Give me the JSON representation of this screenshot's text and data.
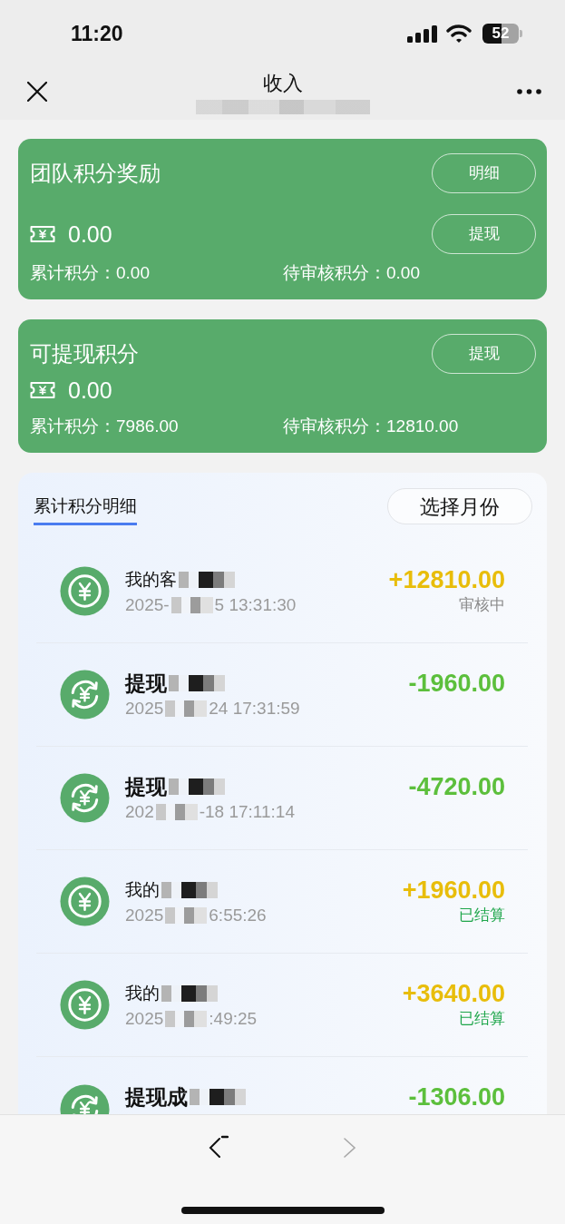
{
  "status_bar": {
    "time": "11:20",
    "battery": "52"
  },
  "nav": {
    "title": "收入"
  },
  "cards": [
    {
      "title": "团队积分奖励",
      "amount": "0.00",
      "buttons": [
        "明细",
        "提现"
      ],
      "stats": [
        "累计积分：0.00",
        "待审核积分：0.00"
      ]
    },
    {
      "title": "可提现积分",
      "amount": "0.00",
      "buttons": [
        "提现"
      ],
      "stats": [
        "累计积分：7986.00",
        "待审核积分：12810.00"
      ]
    }
  ],
  "records": {
    "tabs": [
      {
        "label": "累计积分明细",
        "selected": true
      }
    ],
    "month_button": "选择月份",
    "rows": [
      {
        "kind": "income",
        "title": "我的客",
        "time_start": "2025-",
        "time_end": "5 13:31:30",
        "amount": "+12810.00",
        "status": {
          "kind": "pending",
          "label": "审核中"
        }
      },
      {
        "kind": "withdraw",
        "title": "提现",
        "time_start": "2025",
        "time_end": "24 17:31:59",
        "amount": "-1960.00"
      },
      {
        "kind": "withdraw",
        "title": "提现",
        "time_start": "202",
        "time_end": "-18 17:11:14",
        "amount": "-4720.00"
      },
      {
        "kind": "income",
        "title": "我的",
        "time_start": "2025",
        "time_end": "6:55:26",
        "amount": "+1960.00",
        "status": {
          "kind": "settled",
          "label": "已结算"
        }
      },
      {
        "kind": "income",
        "title": "我的",
        "time_start": "2025",
        "time_end": ":49:25",
        "amount": "+3640.00",
        "status": {
          "kind": "settled",
          "label": "已结算"
        }
      },
      {
        "kind": "withdraw",
        "title": "提现成",
        "amount": "-1306.00"
      }
    ]
  },
  "toolbar": [
    {
      "kind": "back",
      "disabled": false
    },
    {
      "kind": "forward",
      "disabled": true
    }
  ]
}
